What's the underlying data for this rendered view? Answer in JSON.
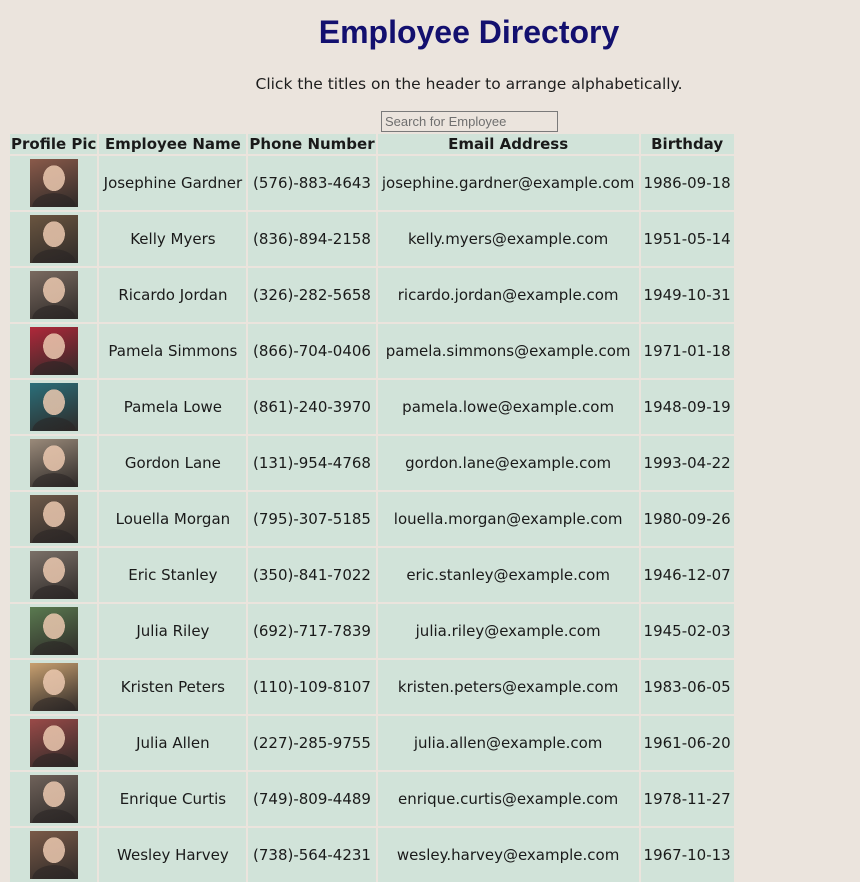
{
  "page": {
    "title": "Employee Directory",
    "subtitle": "Click the titles on the header to arrange alphabetically."
  },
  "search": {
    "placeholder": "Search for Employee",
    "value": ""
  },
  "table": {
    "headers": [
      "Profile Pic",
      "Employee Name",
      "Phone Number",
      "Email Address",
      "Birthday"
    ],
    "rows": [
      {
        "name": "Josephine Gardner",
        "phone": "(576)-883-4643",
        "email": "josephine.gardner@example.com",
        "birthday": "1986-09-18",
        "avatar_color": "#8a5a4a"
      },
      {
        "name": "Kelly Myers",
        "phone": "(836)-894-2158",
        "email": "kelly.myers@example.com",
        "birthday": "1951-05-14",
        "avatar_color": "#6a5540"
      },
      {
        "name": "Ricardo Jordan",
        "phone": "(326)-282-5658",
        "email": "ricardo.jordan@example.com",
        "birthday": "1949-10-31",
        "avatar_color": "#7a6a60"
      },
      {
        "name": "Pamela Simmons",
        "phone": "(866)-704-0406",
        "email": "pamela.simmons@example.com",
        "birthday": "1971-01-18",
        "avatar_color": "#b0283a"
      },
      {
        "name": "Pamela Lowe",
        "phone": "(861)-240-3970",
        "email": "pamela.lowe@example.com",
        "birthday": "1948-09-19",
        "avatar_color": "#2a6f7a"
      },
      {
        "name": "Gordon Lane",
        "phone": "(131)-954-4768",
        "email": "gordon.lane@example.com",
        "birthday": "1993-04-22",
        "avatar_color": "#9a8a7a"
      },
      {
        "name": "Louella Morgan",
        "phone": "(795)-307-5185",
        "email": "louella.morgan@example.com",
        "birthday": "1980-09-26",
        "avatar_color": "#6e5a4a"
      },
      {
        "name": "Eric Stanley",
        "phone": "(350)-841-7022",
        "email": "eric.stanley@example.com",
        "birthday": "1946-12-07",
        "avatar_color": "#7b7068"
      },
      {
        "name": "Julia Riley",
        "phone": "(692)-717-7839",
        "email": "julia.riley@example.com",
        "birthday": "1945-02-03",
        "avatar_color": "#5a7a50"
      },
      {
        "name": "Kristen Peters",
        "phone": "(110)-109-8107",
        "email": "kristen.peters@example.com",
        "birthday": "1983-06-05",
        "avatar_color": "#c8a070"
      },
      {
        "name": "Julia Allen",
        "phone": "(227)-285-9755",
        "email": "julia.allen@example.com",
        "birthday": "1961-06-20",
        "avatar_color": "#9a4a48"
      },
      {
        "name": "Enrique Curtis",
        "phone": "(749)-809-4489",
        "email": "enrique.curtis@example.com",
        "birthday": "1978-11-27",
        "avatar_color": "#6f625a"
      },
      {
        "name": "Wesley Harvey",
        "phone": "(738)-564-4231",
        "email": "wesley.harvey@example.com",
        "birthday": "1967-10-13",
        "avatar_color": "#7a5a48"
      }
    ]
  },
  "colors": {
    "background": "#ebe4dd",
    "title": "#13106f",
    "cell_background": "#d1e3d9"
  }
}
